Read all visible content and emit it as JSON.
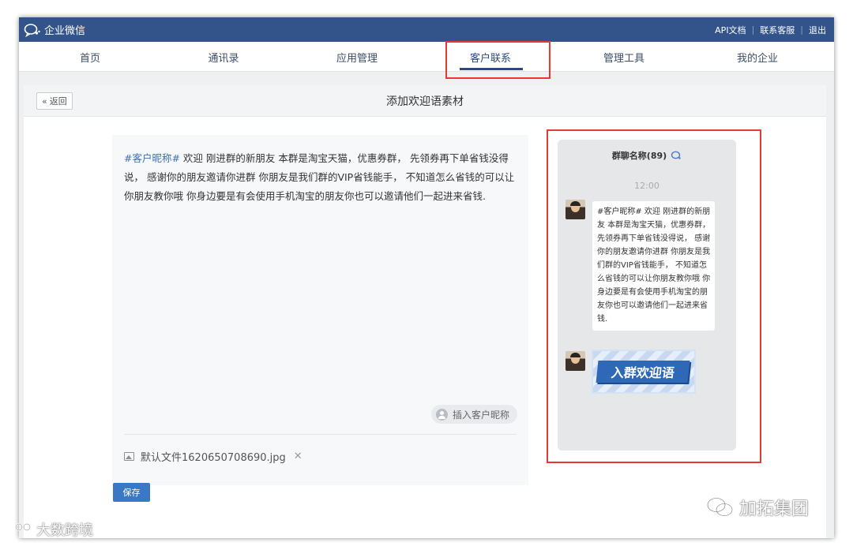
{
  "app": {
    "brand": "企业微信"
  },
  "top_links": [
    "API文档",
    "联系客服",
    "退出"
  ],
  "nav": {
    "items": [
      "首页",
      "通讯录",
      "应用管理",
      "客户联系",
      "管理工具",
      "我的企业"
    ],
    "active": "客户联系"
  },
  "page": {
    "back_label": "返回",
    "title": "添加欢迎语素材"
  },
  "editor": {
    "nickname_tag": "#客户昵称#",
    "message": " 欢迎 刚进群的新朋友 本群是淘宝天猫，优惠券群， 先领券再下单省钱没得说， 感谢你的朋友邀请你进群 你朋友是我们群的VIP省钱能手， 不知道怎么省钱的可以让你朋友教你哦 你身边要是有会使用手机淘宝的朋友你也可以邀请他们一起进来省钱.",
    "insert_nickname_label": "插入客户昵称",
    "file_name": "默认文件1620650708690.jpg",
    "remove_symbol": "✕"
  },
  "save_label": "保存",
  "preview": {
    "group_name": "群聊名称(89)",
    "time": "12:00",
    "bubble_text": "#客户昵称# 欢迎 刚进群的新朋友 本群是淘宝天猫，优惠券群， 先领券再下单省钱没得说， 感谢你的朋友邀请你进群 你朋友是我们群的VIP省钱能手， 不知道怎么省钱的可以让你朋友教你哦 你身边要是有会使用手机淘宝的朋友你也可以邀请他们一起进来省钱.",
    "banner_text": "入群欢迎语"
  },
  "watermarks": {
    "right": "加拓集团",
    "left": "大数跨境"
  },
  "colors": {
    "topbar": "#32548a",
    "accent": "#2b4a7e",
    "highlight": "#e53935",
    "save_button": "#3a78c6",
    "tag": "#3d6fb4"
  },
  "icons": [
    "wechat-work-logo-icon",
    "double-chevron-left-icon",
    "user-icon",
    "image-icon",
    "close-icon",
    "chat-bubble-icon",
    "wechat-icon"
  ]
}
